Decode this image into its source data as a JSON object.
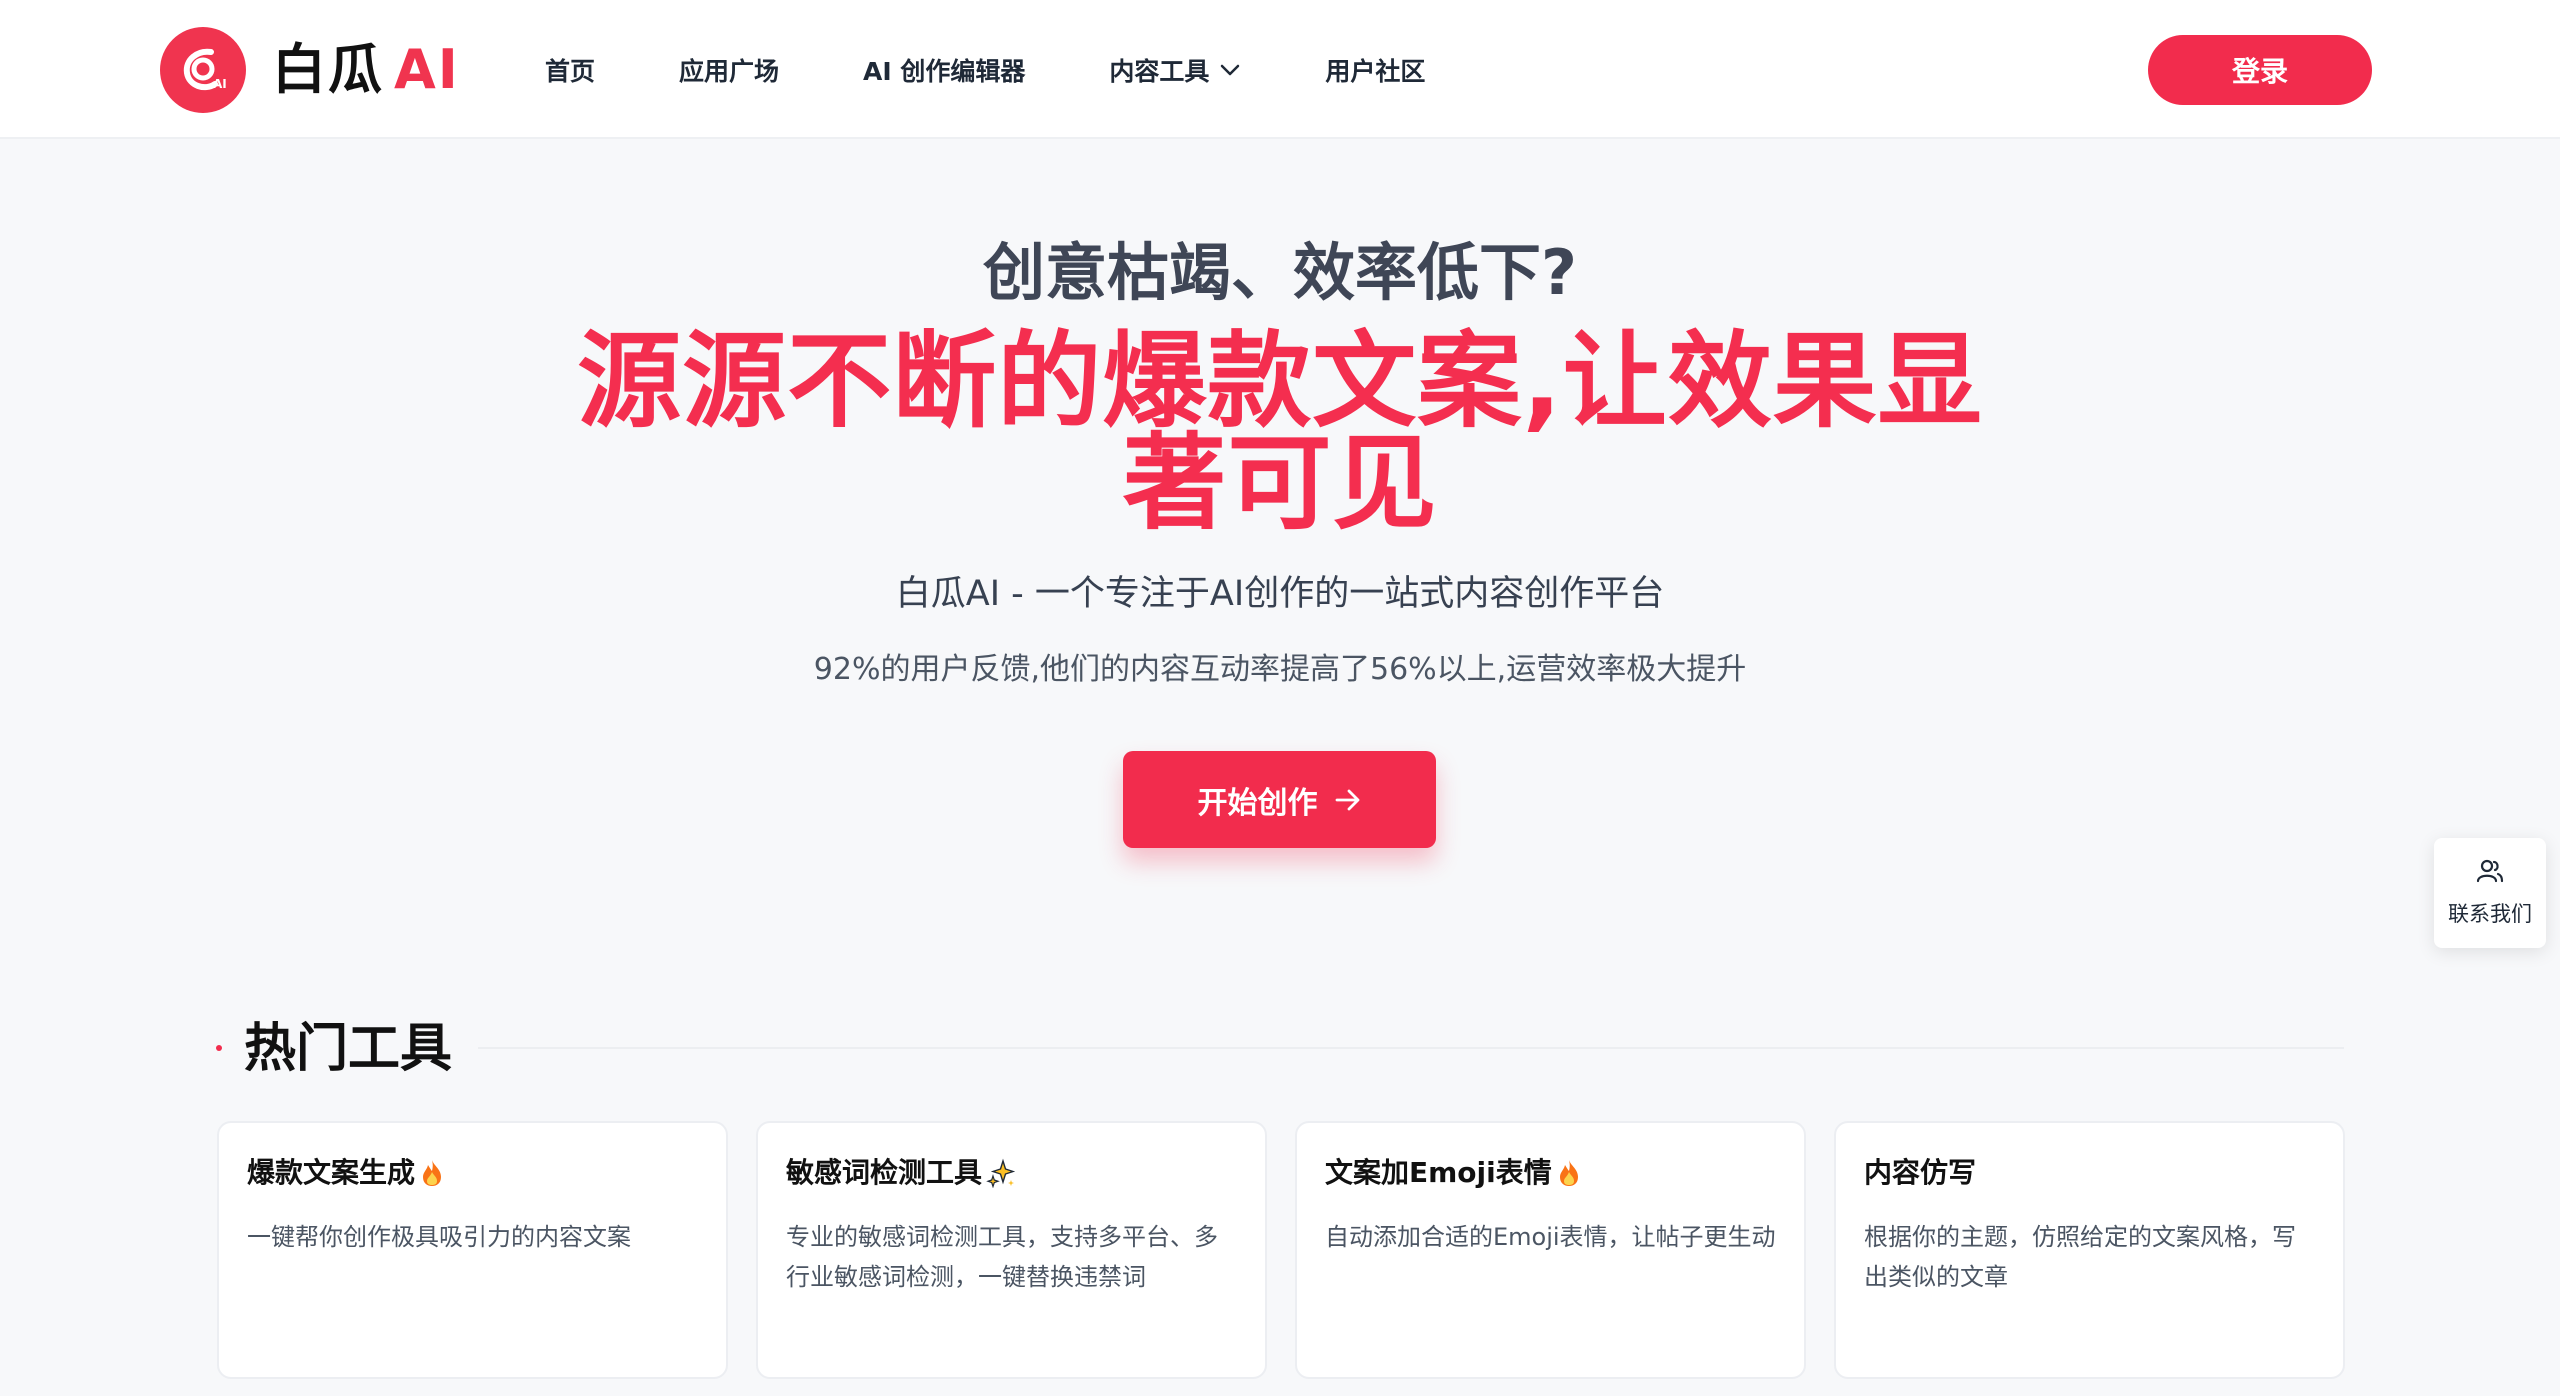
{
  "header": {
    "logo_text": "白瓜",
    "logo_ai": "AI",
    "nav": [
      {
        "label": "首页"
      },
      {
        "label": "应用广场"
      },
      {
        "label": "AI 创作编辑器"
      },
      {
        "label": "内容工具",
        "has_dropdown": true
      },
      {
        "label": "用户社区"
      }
    ],
    "login_label": "登录"
  },
  "hero": {
    "question": "创意枯竭、效率低下?",
    "headline": "源源不断的爆款文案,让效果显著可见",
    "subtitle": "白瓜AI - 一个专注于AI创作的一站式内容创作平台",
    "stat": "92%的用户反馈,他们的内容互动率提高了56%以上,运营效率极大提升",
    "cta_label": "开始创作"
  },
  "contact": {
    "label": "联系我们",
    "icon": "users-icon"
  },
  "hot_tools": {
    "title": "热门工具",
    "cards": [
      {
        "title": "爆款文案生成",
        "emoji": "fire",
        "description": "一键帮你创作极具吸引力的内容文案"
      },
      {
        "title": "敏感词检测工具",
        "emoji": "sparkles",
        "description": "专业的敏感词检测工具，支持多平台、多行业敏感词检测，一键替换违禁词"
      },
      {
        "title": "文案加Emoji表情",
        "emoji": "fire",
        "description": "自动添加合适的Emoji表情，让帖子更生动"
      },
      {
        "title": "内容仿写",
        "emoji": "",
        "description": "根据你的主题，仿照给定的文案风格，写出类似的文章"
      }
    ]
  },
  "colors": {
    "brand": "#f22c4d",
    "text": "#1f2937",
    "background": "#f7f8fa"
  }
}
